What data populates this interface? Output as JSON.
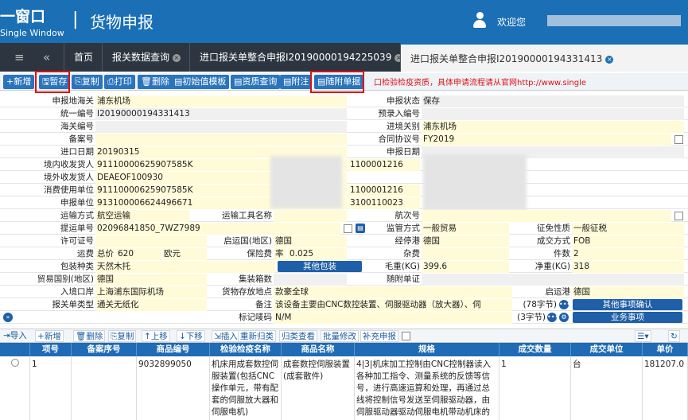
{
  "header": {
    "logo_line1": "一窗口",
    "logo_line2": "Single Window",
    "title": "货物申报",
    "welcome": "欢迎您"
  },
  "tabs": {
    "first": "首页",
    "t1": "报关数据查询",
    "t2": "进口报关单整合申报I20190000194225039",
    "t3": "进口报关单整合申报I20190000194331413"
  },
  "toolbar": {
    "new": "+新增",
    "save": "暂存",
    "copy": "复制",
    "print": "打印",
    "delete": "删除",
    "template": "初始值模板",
    "qualify": "资质查询",
    "attach": "附注",
    "attach_doc": "随附单据",
    "notice": "口检验检疫资质，具体申请流程请从官网http://www.single"
  },
  "form": {
    "decl_customs_l": "申报地海关",
    "decl_customs_v": "浦东机场",
    "status_l": "申报状态",
    "status_v": "保存",
    "unified_no_l": "统一编号",
    "unified_no_v": "I20190000194331413",
    "pre_entry_l": "预录入编号",
    "customs_no_l": "海关编号",
    "entry_customs_l": "进境关别",
    "entry_customs_v": "浦东机场",
    "record_no_l": "备案号",
    "contract_l": "合同协议号",
    "contract_v": "FY2019",
    "import_date_l": "进口日期",
    "import_date_v": "20190315",
    "decl_date_l": "申报日期",
    "consignee_l": "境内收发货人",
    "consignee_v": "91110000625907585K",
    "consignee_code": "1100001216",
    "foreign_l": "境外收发货人",
    "foreign_v": "DEAEOF100930",
    "consumer_l": "消费使用单位",
    "consumer_v": "91110000625907585K",
    "consumer_code": "1100001216",
    "declarant_l": "申报单位",
    "declarant_v": "913100006624496671",
    "declarant_code": "3100110023",
    "transport_l": "运输方式",
    "transport_v": "航空运输",
    "vehicle_l": "运输工具名称",
    "voyage_l": "航次号",
    "bl_l": "提运单号",
    "bl_v": "02096841850_7WZ7989",
    "supervision_l": "监管方式",
    "supervision_v": "一般贸易",
    "tax_l": "征免性质",
    "tax_v": "一般征税",
    "license_l": "许可证号",
    "origin_country_l": "启运国(地区)",
    "origin_country_v": "德国",
    "transit_l": "经停港",
    "transit_v": "德国",
    "deal_l": "成交方式",
    "deal_v": "FOB",
    "freight_l": "运费",
    "freight_type": "总价",
    "freight_v": "620",
    "freight_cur": "欧元",
    "insurance_l": "保险费",
    "insurance_type": "率",
    "insurance_v": "0.025",
    "misc_l": "杂费",
    "pieces_l": "件数",
    "pieces_v": "2",
    "pack_l": "包装种类",
    "pack_v": "天然木托",
    "other_pack": "其他包装",
    "gross_l": "毛重(KG)",
    "gross_v": "399.6",
    "net_l": "净重(KG)",
    "net_v": "318",
    "trade_country_l": "贸易国别(地区)",
    "trade_country_v": "德国",
    "container_l": "集装箱数",
    "doc_l": "随附单证",
    "entry_port_l": "入境口岸",
    "entry_port_v": "上海浦东国际机场",
    "storage_l": "货物存放地点",
    "storage_v": "款豪全球",
    "dep_port_l": "启运港",
    "dep_port_v": "德国",
    "decl_type_l": "报关单类型",
    "decl_type_v": "通关无纸化",
    "remark_l": "备注",
    "remark_v": "该设备主要由CNC数控装置、伺服驱动器（放大器）、伺",
    "remark_count": "(78字节)",
    "other_confirm": "其他事项确认",
    "mark_l": "标记唛码",
    "mark_v": "N/M",
    "mark_count": "(3字节)",
    "business": "业务事项"
  },
  "grid_toolbar": {
    "import": "导入",
    "add": "新增",
    "delete": "删除",
    "copy": "复制",
    "up": "上移",
    "down": "下移",
    "insert": "插入",
    "reclassify": "重新归类",
    "check": "归类查看",
    "batch": "批量修改",
    "supplement": "补充申报"
  },
  "grid": {
    "headers": [
      "项号",
      "备案序号",
      "商品编号",
      "检验检疫名称",
      "商品名称",
      "规格",
      "成交数量",
      "成交单位",
      "单价"
    ],
    "row": {
      "no": "1",
      "code": "9032899050",
      "ciq_name": "机床用成套数控伺服装置(包括CNC操作单元，带有配套的伺服放大器和伺服电机)",
      "name": "成套数控伺服装置(成套散件)",
      "spec": "4|3|机床加工控制由CNC控制器读入各种加工指令、测量系统的反馈等信号，进行高速运算和处理，再通过总线将控制信号发送至伺服驱动器，由伺服驱动器驱动伺服电机带动机床的",
      "qty": "1",
      "unit": "台",
      "price": "181207.0"
    }
  }
}
